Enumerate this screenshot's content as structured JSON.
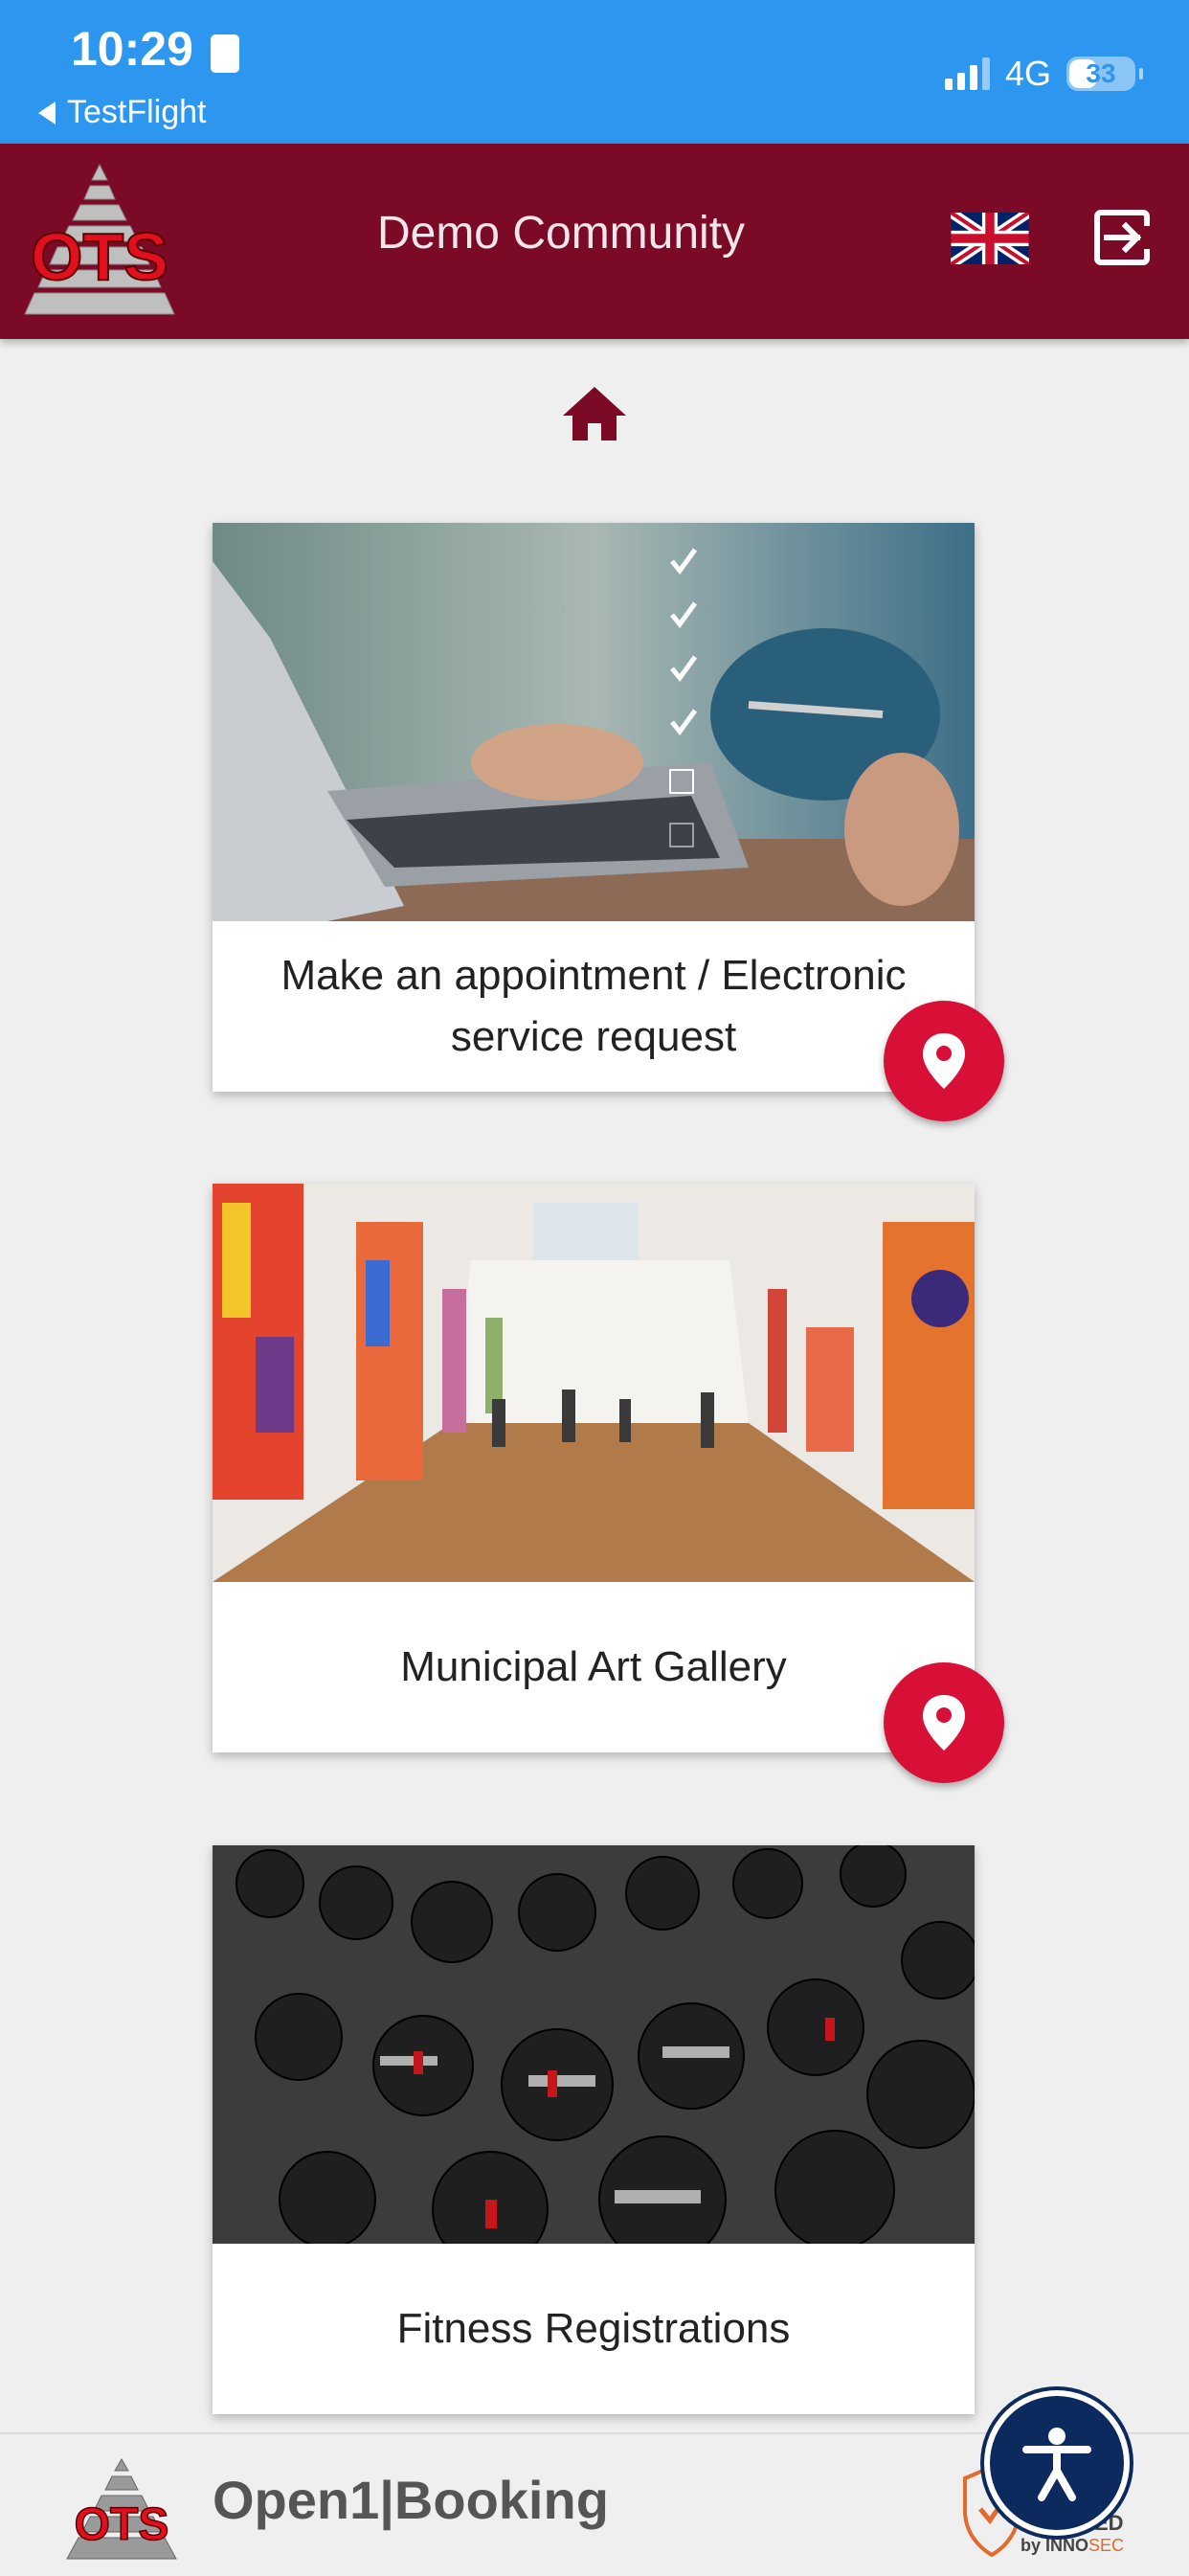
{
  "status_bar": {
    "time": "10:29",
    "back_label": "TestFlight",
    "network": "4G",
    "battery": "33"
  },
  "header": {
    "logo_text": "OTS",
    "title": "Demo Community",
    "language_icon": "uk-flag-icon",
    "logout_icon": "logout-icon"
  },
  "home_icon": "home-icon",
  "cards": [
    {
      "label": "Make an appointment / Electronic service request",
      "has_location": true
    },
    {
      "label": "Municipal Art Gallery",
      "has_location": true
    },
    {
      "label": "Fitness Registrations",
      "has_location": false
    }
  ],
  "footer": {
    "logo_text": "OTS",
    "brand": "Open1|Booking",
    "secured_label": "SECURED",
    "secured_by": "by ",
    "secured_company_a": "INNO",
    "secured_company_b": "SEC"
  },
  "colors": {
    "status_bar": "#2d96ee",
    "header": "#7b0a26",
    "accent_red": "#d80f37",
    "background": "#efefef"
  }
}
